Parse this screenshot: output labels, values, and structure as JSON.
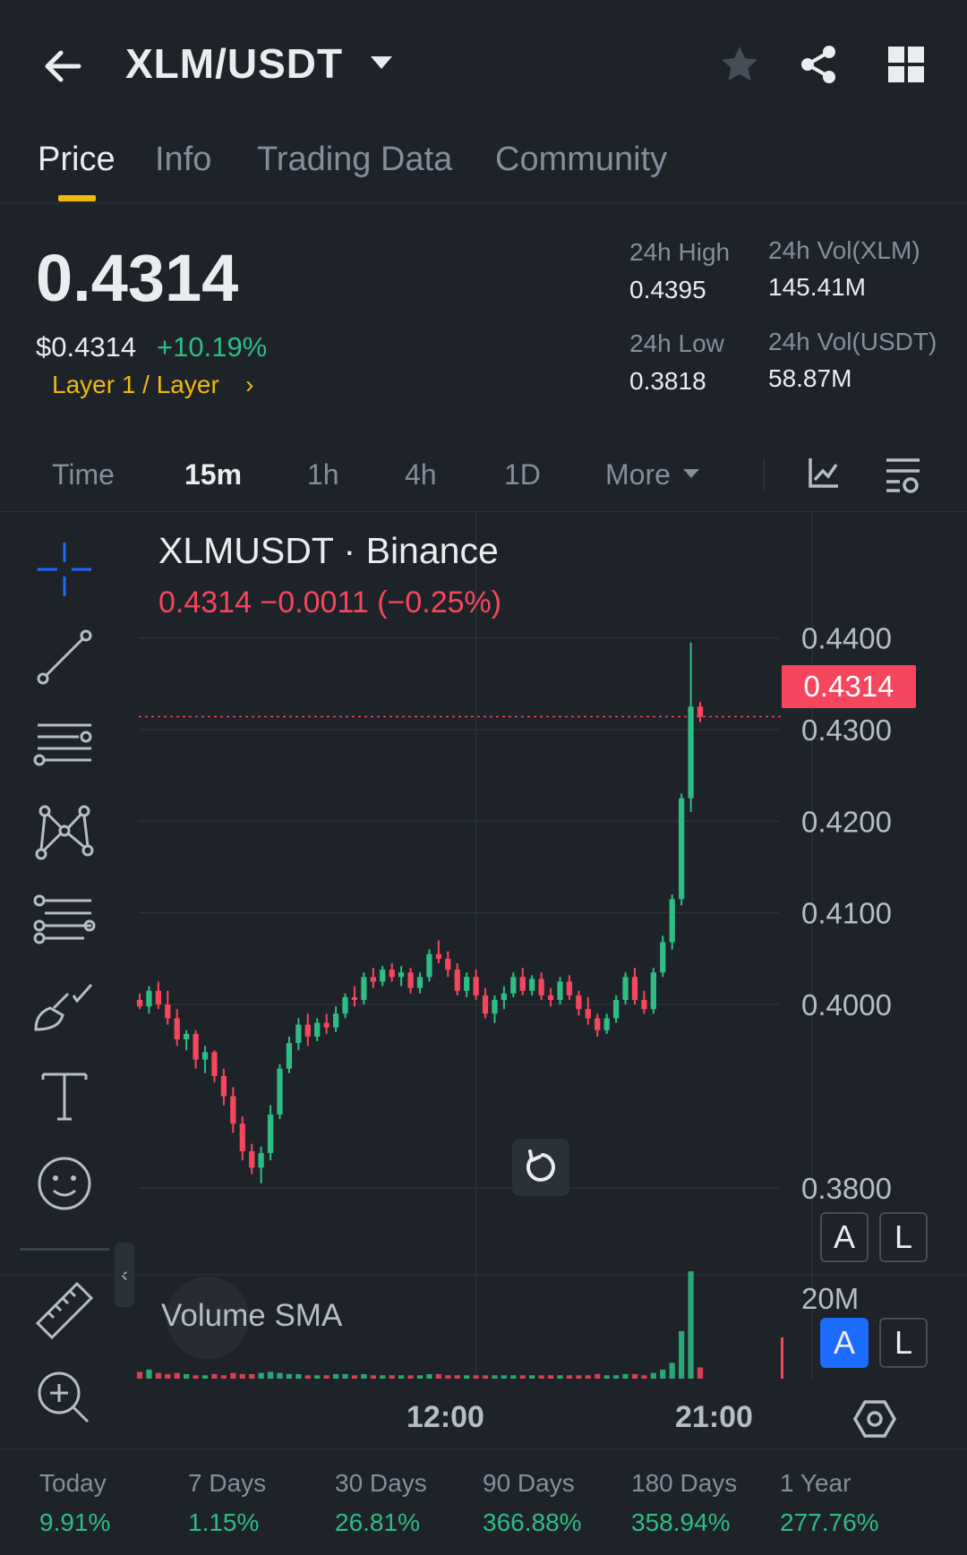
{
  "header": {
    "pair": "XLM/USDT",
    "icons": [
      "back-arrow-icon",
      "caret-down-icon",
      "star-icon",
      "share-icon",
      "grid-icon"
    ]
  },
  "tabs": [
    {
      "label": "Price",
      "active": true
    },
    {
      "label": "Info",
      "active": false
    },
    {
      "label": "Trading Data",
      "active": false
    },
    {
      "label": "Community",
      "active": false
    }
  ],
  "ticker": {
    "last_price": "0.4314",
    "usd_price": "$0.4314",
    "change_pct": "+10.19%",
    "category": "Layer 1 / Layer",
    "category_arrow": "›",
    "stats": {
      "high_label": "24h High",
      "high": "0.4395",
      "low_label": "24h Low",
      "low": "0.3818",
      "vol_base_label": "24h Vol(XLM)",
      "vol_base": "145.41M",
      "vol_quote_label": "24h Vol(USDT)",
      "vol_quote": "58.87M"
    }
  },
  "intervals": {
    "items": [
      "Time",
      "15m",
      "1h",
      "4h",
      "1D",
      "More"
    ],
    "active": "15m",
    "icons": [
      "indicator-icon",
      "chart-settings-icon"
    ]
  },
  "toolbar": {
    "icons": [
      "crosshair-icon",
      "trend-line-icon",
      "horizontal-lines-icon",
      "pattern-icon",
      "fib-icon",
      "brush-icon",
      "text-icon",
      "emoji-icon",
      "ruler-icon",
      "zoom-in-icon"
    ],
    "collapse": "‹"
  },
  "chart": {
    "title": "XLMUSDT · Binance",
    "ohlc_line": "0.4314  −0.0011 (−0.25%)",
    "price_tag": "0.4314",
    "axis_ticks": [
      "0.4400",
      "0.4300",
      "0.4200",
      "0.4100",
      "0.4000",
      "0.3800"
    ],
    "volume_label": "Volume SMA",
    "volume_axis": "20M",
    "time_labels": [
      "12:00",
      "21:00"
    ],
    "buttons": {
      "a": "A",
      "l": "L"
    },
    "colors": {
      "up": "#2ebd85",
      "down": "#f6465d",
      "background": "#1e2329",
      "grid": "#2b3139"
    }
  },
  "chart_data": {
    "type": "candlestick",
    "title": "XLMUSDT · Binance",
    "y_range": [
      0.3795,
      0.442
    ],
    "x_labels": {
      "12:00": 36,
      "21:00": 72
    },
    "candles": [
      [
        0.4005,
        0.4012,
        0.3995,
        0.3998
      ],
      [
        0.3998,
        0.402,
        0.399,
        0.4015
      ],
      [
        0.4015,
        0.4025,
        0.3995,
        0.4
      ],
      [
        0.4,
        0.4015,
        0.3978,
        0.3985
      ],
      [
        0.3985,
        0.3995,
        0.3955,
        0.3962
      ],
      [
        0.3962,
        0.3972,
        0.395,
        0.3968
      ],
      [
        0.3968,
        0.3972,
        0.393,
        0.394
      ],
      [
        0.394,
        0.3955,
        0.3925,
        0.3948
      ],
      [
        0.3948,
        0.395,
        0.3915,
        0.3922
      ],
      [
        0.3922,
        0.393,
        0.389,
        0.39
      ],
      [
        0.39,
        0.391,
        0.386,
        0.387
      ],
      [
        0.387,
        0.3878,
        0.383,
        0.384
      ],
      [
        0.384,
        0.3848,
        0.3815,
        0.3822
      ],
      [
        0.3822,
        0.3845,
        0.3805,
        0.3838
      ],
      [
        0.3838,
        0.389,
        0.383,
        0.388
      ],
      [
        0.388,
        0.3935,
        0.3875,
        0.393
      ],
      [
        0.393,
        0.3965,
        0.3925,
        0.3958
      ],
      [
        0.3958,
        0.3985,
        0.395,
        0.3978
      ],
      [
        0.3978,
        0.399,
        0.3955,
        0.3965
      ],
      [
        0.3965,
        0.3985,
        0.396,
        0.398
      ],
      [
        0.398,
        0.399,
        0.3968,
        0.3975
      ],
      [
        0.3975,
        0.3998,
        0.397,
        0.399
      ],
      [
        0.399,
        0.4012,
        0.3985,
        0.4008
      ],
      [
        0.4008,
        0.402,
        0.3998,
        0.4005
      ],
      [
        0.4005,
        0.4035,
        0.4,
        0.403
      ],
      [
        0.403,
        0.404,
        0.4018,
        0.4025
      ],
      [
        0.4025,
        0.4042,
        0.402,
        0.4038
      ],
      [
        0.4038,
        0.4045,
        0.4025,
        0.403
      ],
      [
        0.403,
        0.4042,
        0.402,
        0.4035
      ],
      [
        0.4035,
        0.404,
        0.4012,
        0.4018
      ],
      [
        0.4018,
        0.4035,
        0.4012,
        0.403
      ],
      [
        0.403,
        0.406,
        0.4025,
        0.4055
      ],
      [
        0.4055,
        0.407,
        0.4045,
        0.405
      ],
      [
        0.405,
        0.4058,
        0.403,
        0.4038
      ],
      [
        0.4038,
        0.4045,
        0.401,
        0.4015
      ],
      [
        0.4015,
        0.4035,
        0.4008,
        0.403
      ],
      [
        0.403,
        0.4038,
        0.4005,
        0.401
      ],
      [
        0.401,
        0.4018,
        0.3985,
        0.399
      ],
      [
        0.399,
        0.401,
        0.398,
        0.4005
      ],
      [
        0.4005,
        0.402,
        0.3995,
        0.4012
      ],
      [
        0.4012,
        0.4035,
        0.4008,
        0.403
      ],
      [
        0.403,
        0.404,
        0.401,
        0.4015
      ],
      [
        0.4015,
        0.4032,
        0.401,
        0.4028
      ],
      [
        0.4028,
        0.4035,
        0.4005,
        0.401
      ],
      [
        0.401,
        0.4018,
        0.3998,
        0.4005
      ],
      [
        0.4005,
        0.403,
        0.4,
        0.4025
      ],
      [
        0.4025,
        0.4032,
        0.4005,
        0.401
      ],
      [
        0.401,
        0.4015,
        0.3988,
        0.3995
      ],
      [
        0.3995,
        0.4008,
        0.3978,
        0.3985
      ],
      [
        0.3985,
        0.399,
        0.3965,
        0.3972
      ],
      [
        0.3972,
        0.399,
        0.3968,
        0.3985
      ],
      [
        0.3985,
        0.401,
        0.398,
        0.4005
      ],
      [
        0.4005,
        0.4035,
        0.4,
        0.403
      ],
      [
        0.403,
        0.404,
        0.4,
        0.4005
      ],
      [
        0.4005,
        0.4015,
        0.399,
        0.3995
      ],
      [
        0.3995,
        0.404,
        0.399,
        0.4035
      ],
      [
        0.4035,
        0.4075,
        0.403,
        0.4068
      ],
      [
        0.4068,
        0.412,
        0.406,
        0.4115
      ],
      [
        0.4115,
        0.423,
        0.4108,
        0.4225
      ],
      [
        0.4225,
        0.4395,
        0.421,
        0.4325
      ],
      [
        0.4325,
        0.433,
        0.4308,
        0.4314
      ]
    ],
    "volume_axis_label": "20M",
    "volumes": [
      0.6,
      0.8,
      0.5,
      0.4,
      0.5,
      0.4,
      0.3,
      0.3,
      0.4,
      0.3,
      0.5,
      0.4,
      0.4,
      0.5,
      0.6,
      0.5,
      0.4,
      0.4,
      0.3,
      0.3,
      0.3,
      0.4,
      0.4,
      0.3,
      0.4,
      0.3,
      0.3,
      0.3,
      0.3,
      0.3,
      0.3,
      0.4,
      0.4,
      0.3,
      0.3,
      0.3,
      0.3,
      0.3,
      0.3,
      0.3,
      0.3,
      0.3,
      0.3,
      0.3,
      0.3,
      0.3,
      0.3,
      0.3,
      0.3,
      0.4,
      0.3,
      0.3,
      0.4,
      0.4,
      0.3,
      0.5,
      0.8,
      1.4,
      4.2,
      9.5,
      1.0
    ]
  },
  "performance": [
    {
      "label": "Today",
      "value": "9.91%"
    },
    {
      "label": "7 Days",
      "value": "1.15%"
    },
    {
      "label": "30 Days",
      "value": "26.81%"
    },
    {
      "label": "90 Days",
      "value": "366.88%"
    },
    {
      "label": "180 Days",
      "value": "358.94%"
    },
    {
      "label": "1 Year",
      "value": "277.76%"
    }
  ]
}
